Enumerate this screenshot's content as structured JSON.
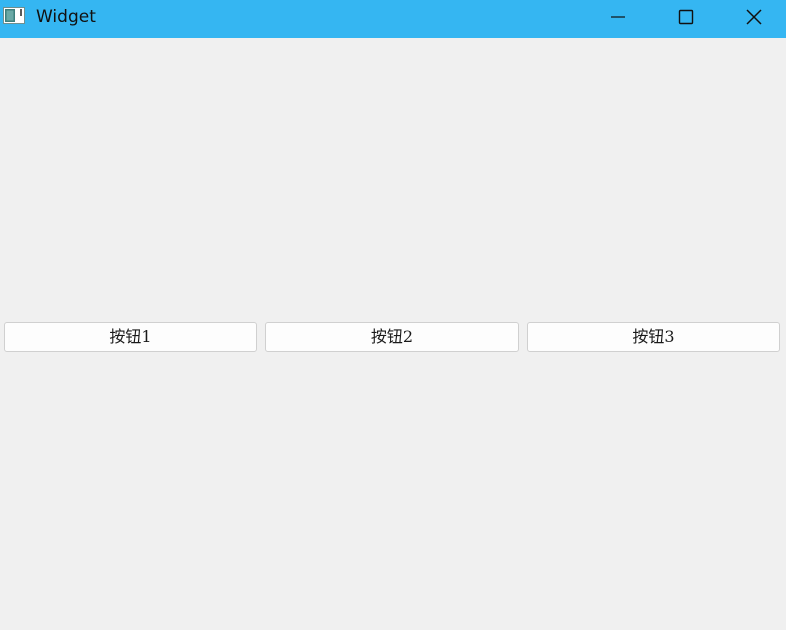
{
  "window": {
    "title": "Widget",
    "titlebar_color": "#35b6f2",
    "icons": {
      "app": "app-window-icon",
      "minimize": "minimize-icon",
      "maximize": "maximize-icon",
      "close": "close-icon"
    }
  },
  "buttons": [
    {
      "label": "按钮1"
    },
    {
      "label": "按钮2"
    },
    {
      "label": "按钮3"
    }
  ]
}
